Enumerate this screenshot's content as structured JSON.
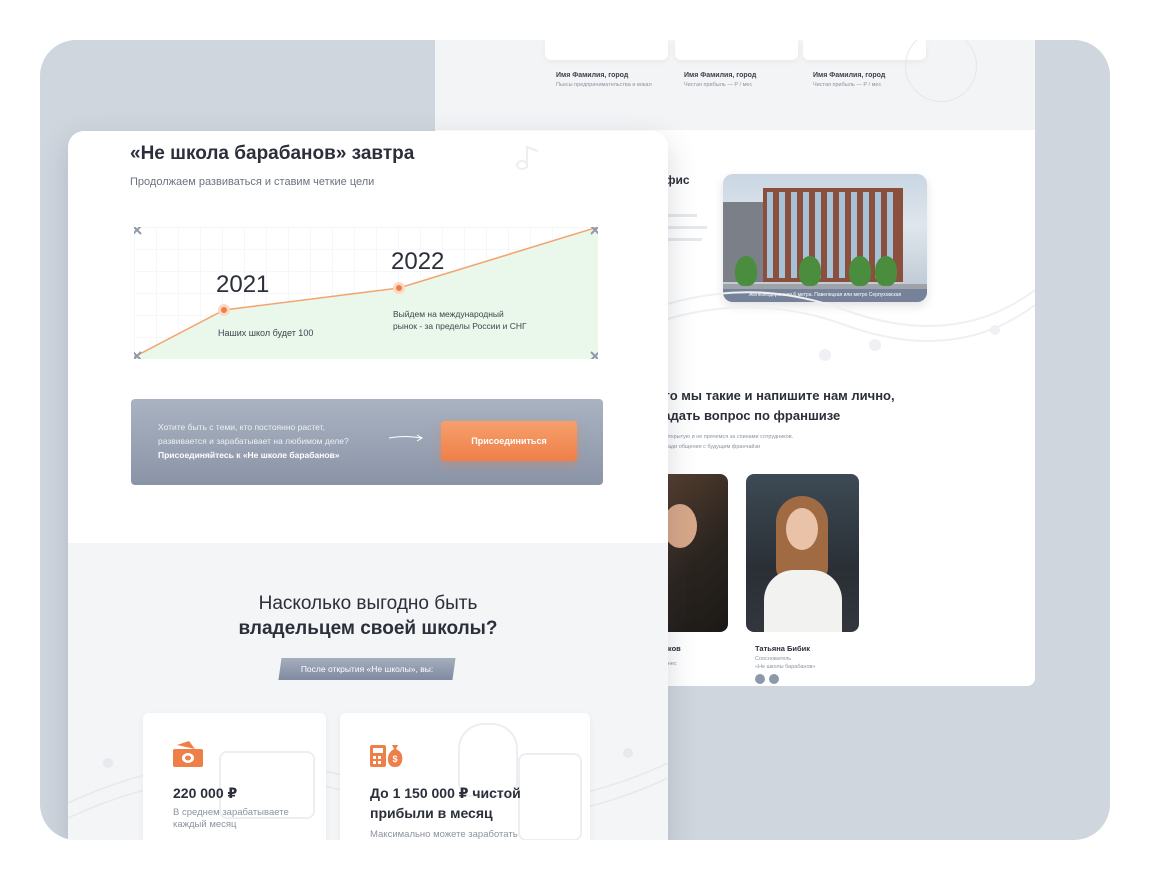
{
  "back": {
    "testimonials": [
      {
        "name": "Имя Фамилия, город",
        "sub": "Пьесы предпринимательства и вокал"
      },
      {
        "name": "Имя Фамилия, город",
        "sub": "Чистая прибыль — Р / мес"
      },
      {
        "name": "Имя Фамилия, город",
        "sub": "Чистая прибыль — Р / мес"
      }
    ],
    "office_title": "фис",
    "office_caption": "Железнодорожная 6 метра. Павелецкая или метро Серпуховская",
    "team_title_1": "кто мы такие и напишите нам лично,",
    "team_title_2": "задать вопрос по франшизе",
    "team_desc_1": "с в открытую и не прячемся за спинами сотрудников.",
    "team_desc_2": "да ради общения с будущим франчайзи",
    "people": [
      {
        "name": "дaков",
        "role": "бизнес"
      },
      {
        "name": "Татьяна Бибик",
        "role_1": "Сооснователь",
        "role_2": "«Не школы барабанов»"
      }
    ]
  },
  "front": {
    "title": "«Не школа барабанов» завтра",
    "subtitle": "Продолжаем развиваться и ставим четкие цели",
    "timeline": [
      {
        "year": "2021",
        "note": "Наших школ будет 100"
      },
      {
        "year": "2022",
        "note_1": "Выйдем на международный",
        "note_2": "рынок - за пределы России и СНГ"
      }
    ],
    "cta": {
      "line_1": "Хотите быть с теми, кто постоянно растет,",
      "line_2": "развивается и зарабатывает на любимом деле?",
      "line_3": "Присоединяйтесь к «Не школе барабанов»",
      "button": "Присоединиться"
    },
    "question_1": "Насколько выгодно быть",
    "question_2": "владельцем своей школы?",
    "pill": "После открытия «Не школы», вы:",
    "cards": [
      {
        "value": "220 000 ₽",
        "desc_1": "В среднем зарабатываете",
        "desc_2": "каждый месяц",
        "icon": "money-icon"
      },
      {
        "value_1": "До 1 150 000 ₽ чистой",
        "value_2": "прибыли в месяц",
        "desc_1": "Максимально можете заработать",
        "icon": "calculator-icon"
      }
    ]
  },
  "colors": {
    "accent": "#ef7f48",
    "frame": "#cfd6de",
    "chart_fill": "#e9f8ea",
    "chart_line": "#f4a36f"
  }
}
